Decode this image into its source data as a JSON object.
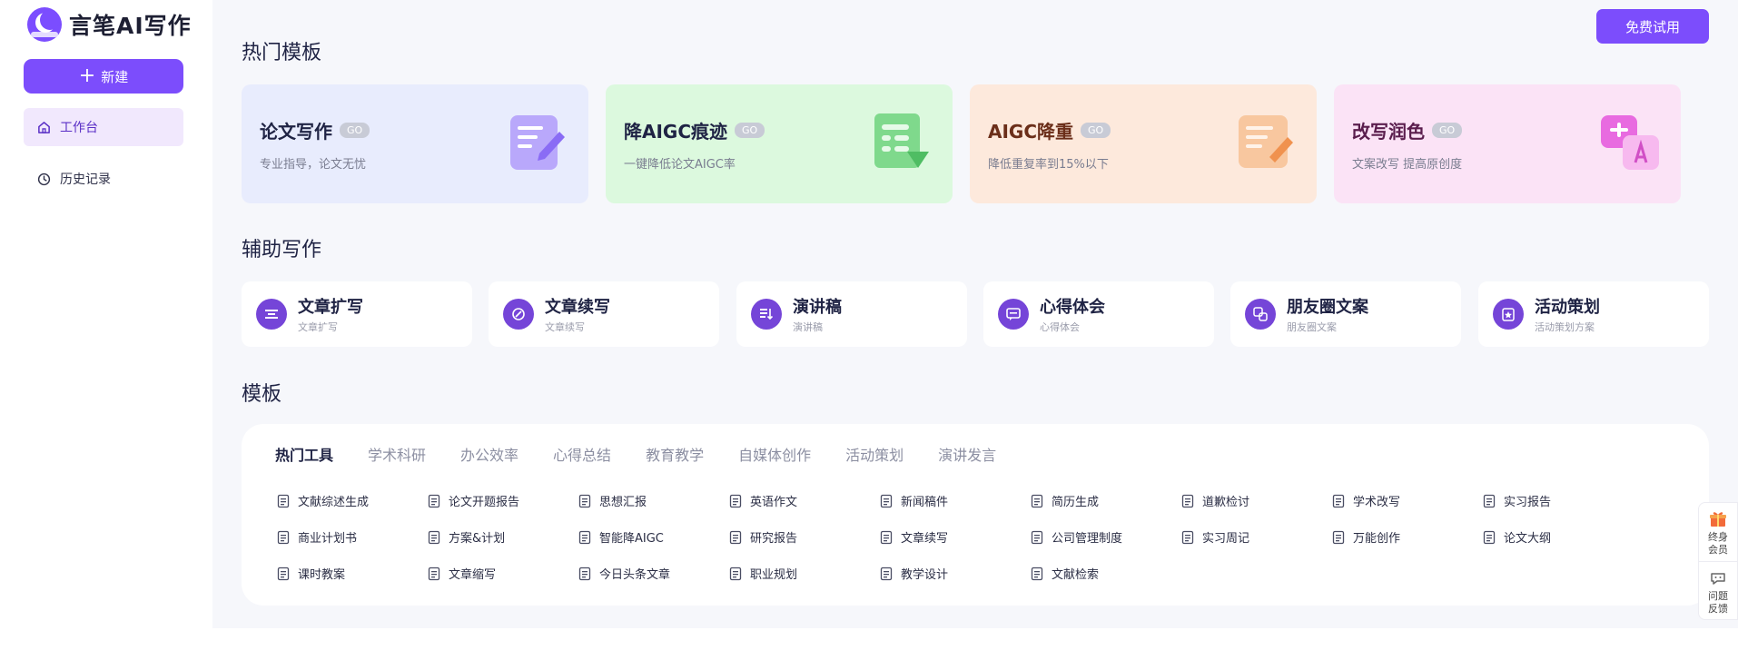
{
  "app": {
    "name": "言笔AI写作",
    "new_label": "新建",
    "trial_label": "免费试用"
  },
  "sidebar": {
    "items": [
      {
        "label": "工作台",
        "icon": "home-icon",
        "active": true
      },
      {
        "label": "历史记录",
        "icon": "clock-icon",
        "active": false
      }
    ]
  },
  "hot": {
    "title": "热门模板",
    "go": "GO",
    "cards": [
      {
        "title": "论文写作",
        "sub": "专业指导，论文无忧",
        "bg": "#e8ecfd",
        "color": "#1f2344",
        "icon": "essay-icon"
      },
      {
        "title": "降AIGC痕迹",
        "sub": "一键降低论文AIGC率",
        "bg": "#dcf9de",
        "color": "#1f2344",
        "icon": "reduce-trace-icon"
      },
      {
        "title": "AIGC降重",
        "sub": "降低重复率到15%以下",
        "bg": "#fde9dc",
        "color": "#6b2e19",
        "icon": "dedup-icon"
      },
      {
        "title": "改写润色",
        "sub": "文案改写 提高原创度",
        "bg": "#fbe3f6",
        "color": "#5a1d4d",
        "icon": "rewrite-icon"
      }
    ]
  },
  "assist": {
    "title": "辅助写作",
    "cards": [
      {
        "title": "文章扩写",
        "sub": "文章扩写",
        "icon": "expand-icon"
      },
      {
        "title": "文章续写",
        "sub": "文章续写",
        "icon": "continue-icon"
      },
      {
        "title": "演讲稿",
        "sub": "演讲稿",
        "icon": "speech-icon"
      },
      {
        "title": "心得体会",
        "sub": "心得体会",
        "icon": "insight-icon"
      },
      {
        "title": "朋友圈文案",
        "sub": "朋友圈文案",
        "icon": "moments-icon"
      },
      {
        "title": "活动策划",
        "sub": "活动策划方案",
        "icon": "event-icon"
      }
    ]
  },
  "templates": {
    "title": "模板",
    "tabs": [
      "热门工具",
      "学术科研",
      "办公效率",
      "心得总结",
      "教育教学",
      "自媒体创作",
      "活动策划",
      "演讲发言"
    ],
    "active_tab": "热门工具",
    "tools": [
      {
        "label": "文献综述生成"
      },
      {
        "label": "论文开题报告"
      },
      {
        "label": "思想汇报"
      },
      {
        "label": "英语作文"
      },
      {
        "label": "新闻稿件"
      },
      {
        "label": "简历生成"
      },
      {
        "label": "道歉检讨"
      },
      {
        "label": "学术改写"
      },
      {
        "label": "实习报告"
      },
      {
        "label": "商业计划书"
      },
      {
        "label": "方案&计划"
      },
      {
        "label": "智能降AIGC"
      },
      {
        "label": "研究报告"
      },
      {
        "label": "文章续写"
      },
      {
        "label": "公司管理制度"
      },
      {
        "label": "实习周记"
      },
      {
        "label": "万能创作"
      },
      {
        "label": "论文大纲"
      },
      {
        "label": "课时教案"
      },
      {
        "label": "文章缩写"
      },
      {
        "label": "今日头条文章"
      },
      {
        "label": "职业规划"
      },
      {
        "label": "教学设计"
      },
      {
        "label": "文献检索"
      }
    ]
  },
  "float": {
    "items": [
      {
        "label": "终身会员",
        "icon": "gift-icon"
      },
      {
        "label": "问题反馈",
        "icon": "feedback-icon"
      }
    ]
  },
  "colors": {
    "accent": "#7c4dfc",
    "icon_circle": "#7545d8"
  }
}
